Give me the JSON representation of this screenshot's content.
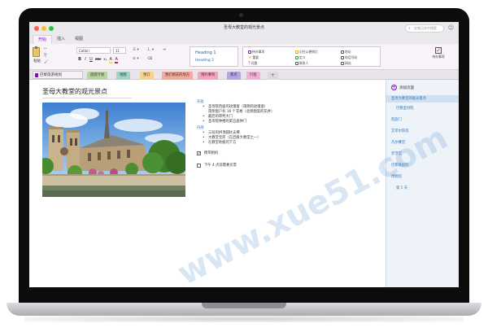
{
  "window": {
    "title": "圣母大教堂的观光景点",
    "search_placeholder": "在笔记本中搜索"
  },
  "ribbon_tabs": [
    "开始",
    "插入",
    "视图"
  ],
  "ribbon": {
    "paste": "粘贴",
    "font_name": "Calibri",
    "font_size": "11",
    "format_buttons": [
      "B",
      "I",
      "U",
      "abc",
      "x₂",
      "A",
      "A"
    ],
    "style_heading1": "Heading 1",
    "style_heading2": "Heading 2",
    "tags": [
      {
        "label": "待办事项",
        "icon": "checkbox-icon"
      },
      {
        "label": "重要",
        "icon": "star-icon"
      },
      {
        "label": "问题",
        "icon": "question-icon"
      },
      {
        "label": "记住以便稍后",
        "icon": "highlight-icon"
      },
      {
        "label": "定义",
        "icon": "definition-icon"
      },
      {
        "label": "联系人",
        "icon": "contact-icon"
      },
      {
        "label": "地址",
        "icon": "address-icon"
      },
      {
        "label": "电话号码",
        "icon": "phone-icon"
      },
      {
        "label": "网站",
        "icon": "web-icon"
      }
    ],
    "todo_button": "待办事项"
  },
  "notebook": {
    "name": "巴黎旅游规划"
  },
  "section_tabs": [
    {
      "label": "旅游计划",
      "color": "#b7d59b"
    },
    {
      "label": "地图",
      "color": "#9fd5c9"
    },
    {
      "label": "预订",
      "color": "#f6d28a"
    },
    {
      "label": "我们想去的地方",
      "color": "#f4a99b"
    },
    {
      "label": "预约事项",
      "color": "#f7a2bf"
    },
    {
      "label": "景点",
      "color": "#b9a3e6"
    },
    {
      "label": "行程",
      "color": "#f0b0d8"
    }
  ],
  "section_add": "+",
  "page": {
    "title": "圣母大教堂的观光景点",
    "notes": [
      {
        "type": "heading",
        "text": "开放"
      },
      {
        "type": "bullet",
        "text": "圣母院西面的玫瑰窗（南侧的玫瑰窗）"
      },
      {
        "type": "sub",
        "text": "南侧窗户有 16 个花格（北侧图案的花井）"
      },
      {
        "type": "bullet",
        "text": "最后的审判大门"
      },
      {
        "type": "bullet",
        "text": "圣母院钟楼的第五座钟门"
      },
      {
        "type": "heading",
        "text": "内部"
      },
      {
        "type": "bullet",
        "text": "三层的拱顶圆柱支撑"
      },
      {
        "type": "bullet",
        "text": "大教堂宝库（在后殿大教堂之一）"
      },
      {
        "type": "bullet",
        "text": "在教堂地板的下方"
      }
    ],
    "checks": [
      {
        "checked": true,
        "text": "携带相机"
      },
      {
        "checked": false,
        "text": "下午 4 点前需要买票"
      }
    ]
  },
  "page_list": {
    "add_label": "添加页面",
    "items": [
      {
        "text": "圣母大教堂的观光景点",
        "selected": true,
        "sub": false
      },
      {
        "text": "巴黎圣母院",
        "selected": false,
        "sub": true
      },
      {
        "text": "凯旋门",
        "selected": false,
        "sub": false
      },
      {
        "text": "艾菲尔铁塔",
        "selected": false,
        "sub": false
      },
      {
        "text": "凡尔赛宫",
        "selected": false,
        "sub": false
      },
      {
        "text": "罗浮宫",
        "selected": false,
        "sub": false
      },
      {
        "text": "巴黎歌剧院",
        "selected": false,
        "sub": false
      },
      {
        "text": "博物馆",
        "selected": false,
        "sub": false
      },
      {
        "text": "第 1 天",
        "selected": false,
        "sub": true
      }
    ]
  },
  "watermark": "www.xue51.com"
}
